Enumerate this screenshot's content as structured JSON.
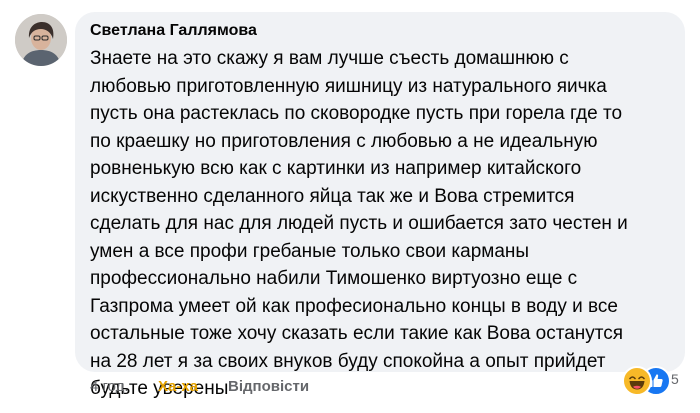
{
  "comment": {
    "author": "Светлана Галлямова",
    "lines": [
      "Знаете на это скажу я вам лучше съесть домашнюю с",
      "любовью приготовленную яишницу из натурального яичка",
      "пусть она растеклась по сковородке пусть при горела где то",
      "по краешку но приготовления с любовью а не идеальную",
      "ровненькую всю как с картинки из  например китайского",
      "искуственно сделанного яйца  так же и Вова стремится",
      "сделать для нас для людей пусть и ошибается зато честен и",
      "умен а все профи гребаные только свои карманы",
      "профессионально набили Тимошенко виртуозно еще с",
      "Газпрома умеет ой как професионально концы в воду и все",
      "остальные тоже  хочу сказать если такие как Вова останутся",
      "на 28 лет я за своих внуков буду спокойна а опыт прийдет",
      "будьте уверены"
    ]
  },
  "actions": {
    "time": "4 год.",
    "reaction_label": "Ха-ха",
    "reply_label": "Відповісти"
  },
  "reactions": {
    "icons": [
      "haha-emoji-icon",
      "like-icon"
    ],
    "count": "5"
  },
  "colors": {
    "bubble": "#f0f2f5",
    "text": "#050505",
    "muted": "#65676b",
    "haha_accent": "#e6a300",
    "like_blue": "#1877f2"
  }
}
